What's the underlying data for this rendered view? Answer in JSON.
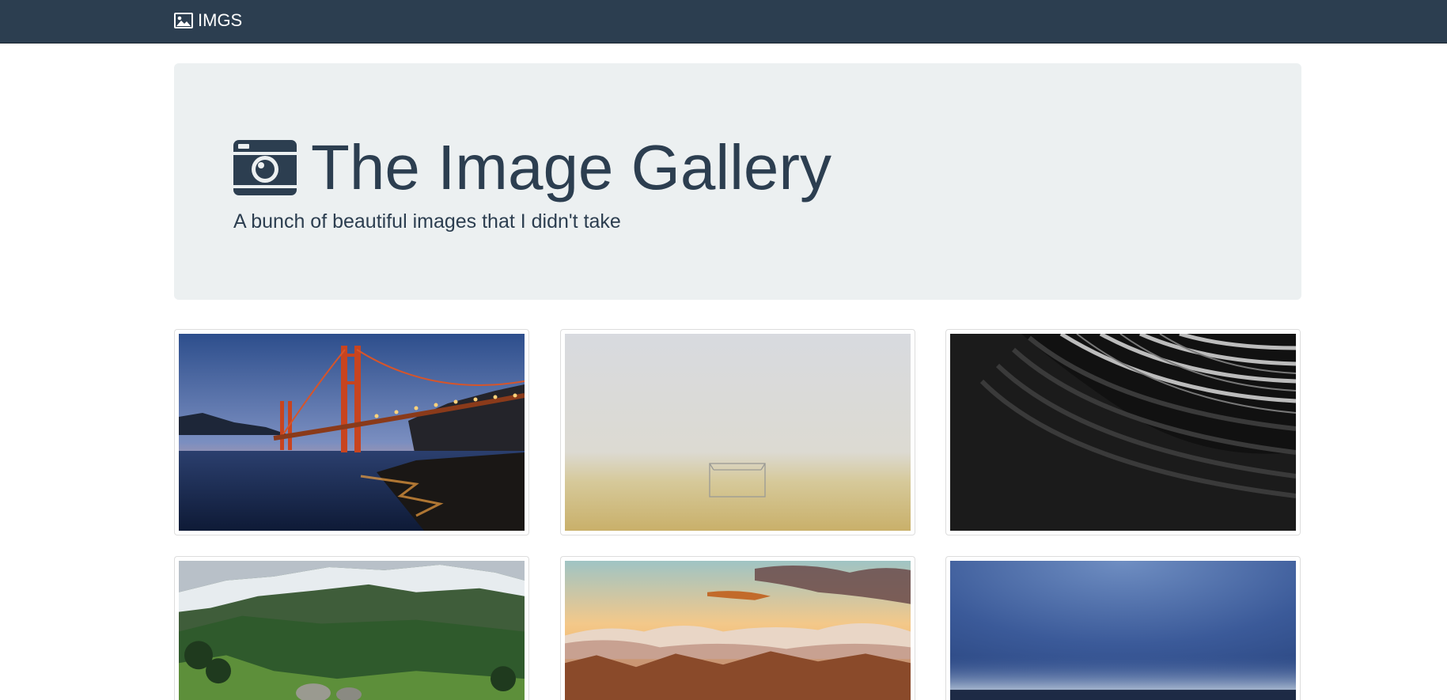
{
  "navbar": {
    "brand_label": "IMGS",
    "brand_icon": "image-icon",
    "background": "#2c3e50"
  },
  "jumbotron": {
    "title": "The Image Gallery",
    "title_icon": "camera-icon",
    "subtitle": "A bunch of beautiful images that I didn't take",
    "background": "#ecf0f1"
  },
  "gallery": {
    "thumbnails": [
      {
        "name": "golden-gate-bridge-image"
      },
      {
        "name": "foggy-soccer-field-image"
      },
      {
        "name": "abstract-architecture-image"
      },
      {
        "name": "snowy-mountains-image"
      },
      {
        "name": "sunset-clouds-image"
      },
      {
        "name": "blue-sky-ocean-image"
      }
    ]
  },
  "colors": {
    "primary": "#2c3e50",
    "light": "#ecf0f1"
  }
}
